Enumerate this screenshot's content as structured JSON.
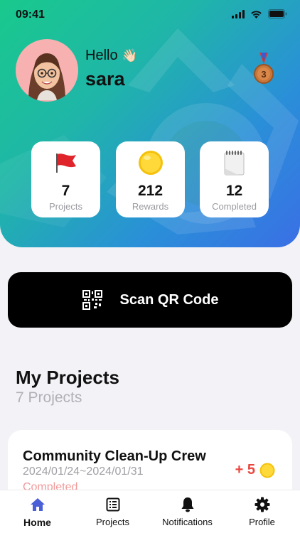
{
  "status_bar": {
    "time": "09:41"
  },
  "header": {
    "greeting": "Hello",
    "greeting_emoji": "👋🏻",
    "username": "sara",
    "medal_rank": "3"
  },
  "stats": [
    {
      "icon": "red-flag-icon",
      "value": "7",
      "label": "Projects"
    },
    {
      "icon": "coin-icon",
      "value": "212",
      "label": "Rewards"
    },
    {
      "icon": "notepad-icon",
      "value": "12",
      "label": "Completed"
    }
  ],
  "scan_button": {
    "label": "Scan QR Code",
    "icon": "qr-code-icon"
  },
  "my_projects": {
    "title": "My Projects",
    "subtitle": "7 Projects",
    "items": [
      {
        "name": "Community Clean-Up Crew",
        "dates": "2024/01/24~2024/01/31",
        "status": "Completed",
        "reward": "+ 5"
      }
    ]
  },
  "tabbar": {
    "items": [
      {
        "label": "Home",
        "icon": "home-icon",
        "active": true
      },
      {
        "label": "Projects",
        "icon": "list-icon",
        "active": false
      },
      {
        "label": "Notifications",
        "icon": "bell-icon",
        "active": false
      },
      {
        "label": "Profile",
        "icon": "gear-icon",
        "active": false
      }
    ]
  },
  "colors": {
    "accent": "#4b5fd6",
    "reward": "#e8473f",
    "completed": "#f19a9a",
    "gradient_start": "#19c98c",
    "gradient_end": "#3a6fe6"
  }
}
